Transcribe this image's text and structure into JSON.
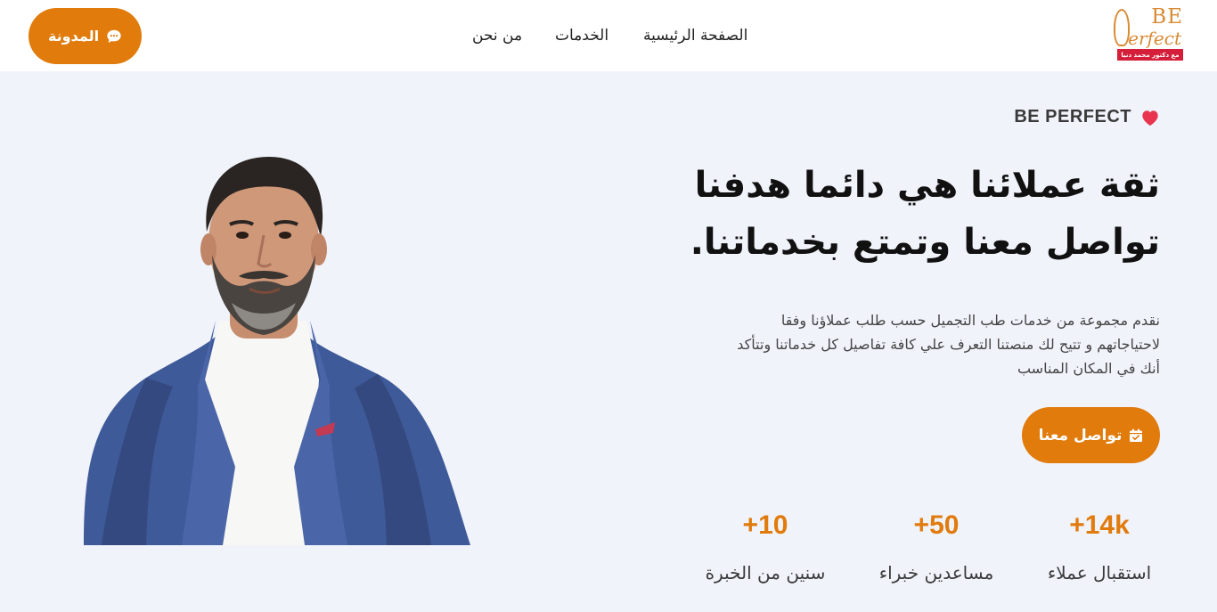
{
  "header": {
    "blog_button": {
      "label": "المدونة",
      "icon": "chat-bubble-icon"
    },
    "nav": {
      "home": "الصفحة الرئيسية",
      "services": "الخدمات",
      "about": "من نحن"
    },
    "logo": {
      "line1": "BE",
      "line2": "erfect",
      "tagline": "مع دكتور محمد دنيا"
    }
  },
  "hero": {
    "tagline": "BE PERFECT",
    "tagline_icon": "heart-icon",
    "headline_line1": "ثقة عملائنا هي دائما هدفنا",
    "headline_line2": "تواصل معنا وتمتع بخدماتنا.",
    "description": "نقدم مجموعة من خدمات طب التجميل حسب طلب عملاؤنا وفقا لاحتياجاتهم و تتيح لك منصتنا التعرف علي كافة تفاصيل كل خدماتنا وتتأكد أنك في المكان المناسب",
    "cta": {
      "label": "تواصل معنا",
      "icon": "calendar-check-icon"
    },
    "stats": [
      {
        "value": "+14k",
        "label": "استقبال عملاء"
      },
      {
        "value": "+50",
        "label": "مساعدين خبراء"
      },
      {
        "value": "+10",
        "label": "سنين من الخبرة"
      }
    ]
  },
  "colors": {
    "accent": "#e07b0c",
    "hero_background": "#f1f3fb",
    "heart": "#e8344e"
  }
}
